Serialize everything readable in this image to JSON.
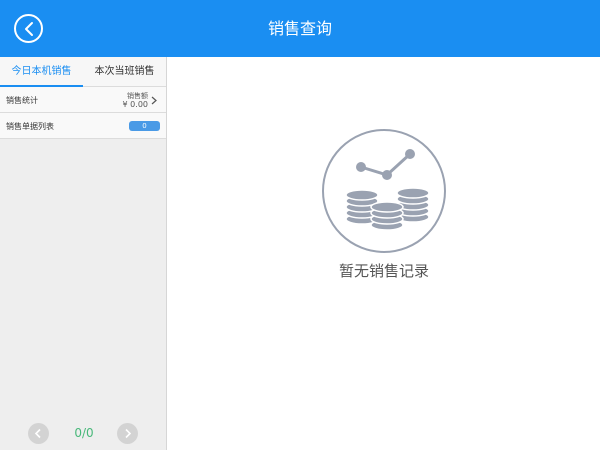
{
  "header": {
    "title": "销售查询",
    "color": "#1a8ef2"
  },
  "tabs": [
    {
      "label": "今日本机销售",
      "active": true
    },
    {
      "label": "本次当班销售",
      "active": false
    }
  ],
  "sidebar": {
    "stats_label": "销售统计",
    "amount_label": "销售额",
    "amount_value": "¥ 0.00",
    "list_label": "销售单据列表",
    "list_count": "0"
  },
  "pager": {
    "text": "0/0"
  },
  "empty_state": {
    "message": "暂无销售记录",
    "icon": "coins-chart-icon"
  }
}
